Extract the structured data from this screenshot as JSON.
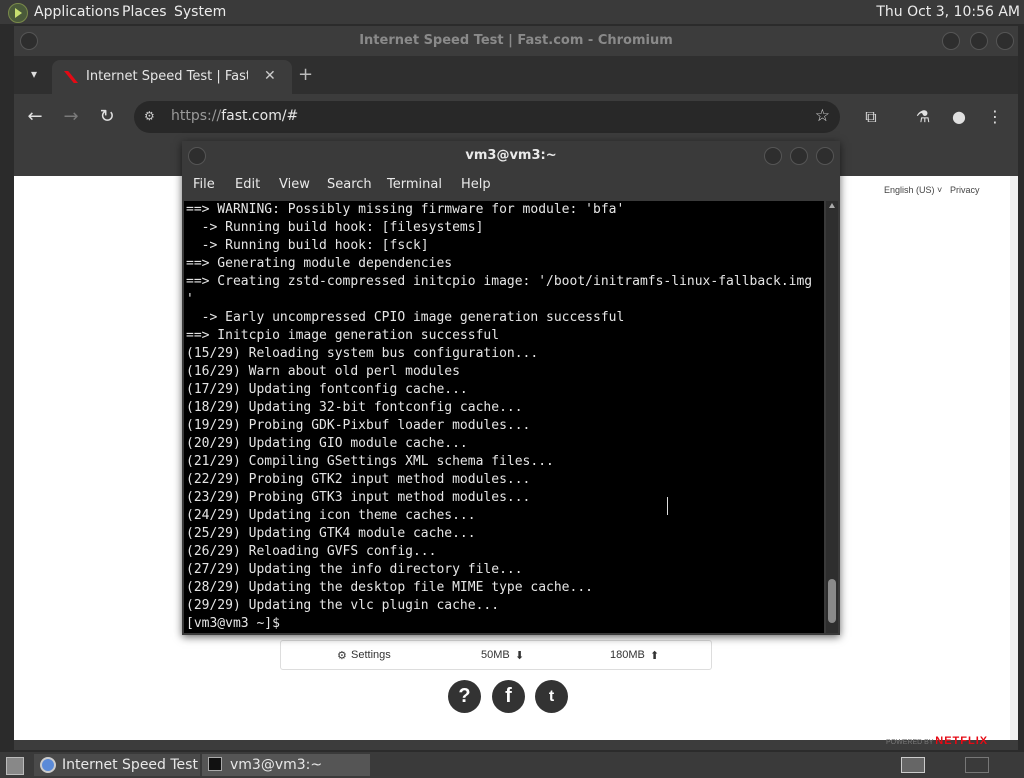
{
  "top_panel": {
    "menus": [
      "Applications",
      "Places",
      "System"
    ],
    "clock": "Thu Oct  3, 10:56 AM"
  },
  "browser": {
    "window_title": "Internet Speed Test | Fast.com - Chromium",
    "tab_title": "Internet Speed Test | Fast.com",
    "url_scheme": "https://",
    "url_rest": "fast.com/#",
    "page": {
      "language": "English (US) ˅",
      "privacy": "Privacy",
      "settings_label": "Settings",
      "upload_value": "50MB",
      "download_value": "180MB",
      "powered_by": "POWERED BY",
      "brand": "NETFLIX",
      "social": [
        "?",
        "f",
        "t"
      ]
    }
  },
  "terminal": {
    "title": "vm3@vm3:~",
    "menu": [
      "File",
      "Edit",
      "View",
      "Search",
      "Terminal",
      "Help"
    ],
    "lines": [
      "==> WARNING: Possibly missing firmware for module: 'bfa'",
      "  -> Running build hook: [filesystems]",
      "  -> Running build hook: [fsck]",
      "==> Generating module dependencies",
      "==> Creating zstd-compressed initcpio image: '/boot/initramfs-linux-fallback.img",
      "'",
      "  -> Early uncompressed CPIO image generation successful",
      "==> Initcpio image generation successful",
      "(15/29) Reloading system bus configuration...",
      "(16/29) Warn about old perl modules",
      "(17/29) Updating fontconfig cache...",
      "(18/29) Updating 32-bit fontconfig cache...",
      "(19/29) Probing GDK-Pixbuf loader modules...",
      "(20/29) Updating GIO module cache...",
      "(21/29) Compiling GSettings XML schema files...",
      "(22/29) Probing GTK2 input method modules...",
      "(23/29) Probing GTK3 input method modules...",
      "(24/29) Updating icon theme caches...",
      "(25/29) Updating GTK4 module cache...",
      "(26/29) Reloading GVFS config...",
      "(27/29) Updating the info directory file...",
      "(28/29) Updating the desktop file MIME type cache...",
      "(29/29) Updating the vlc plugin cache...",
      "[vm3@vm3 ~]$ "
    ]
  },
  "taskbar": {
    "items": [
      "Internet Speed Test ...",
      "vm3@vm3:~"
    ]
  },
  "colors": {
    "netflix_red": "#e50914",
    "terminal_bg": "#000000",
    "panel_bg": "#3a3a3a"
  }
}
